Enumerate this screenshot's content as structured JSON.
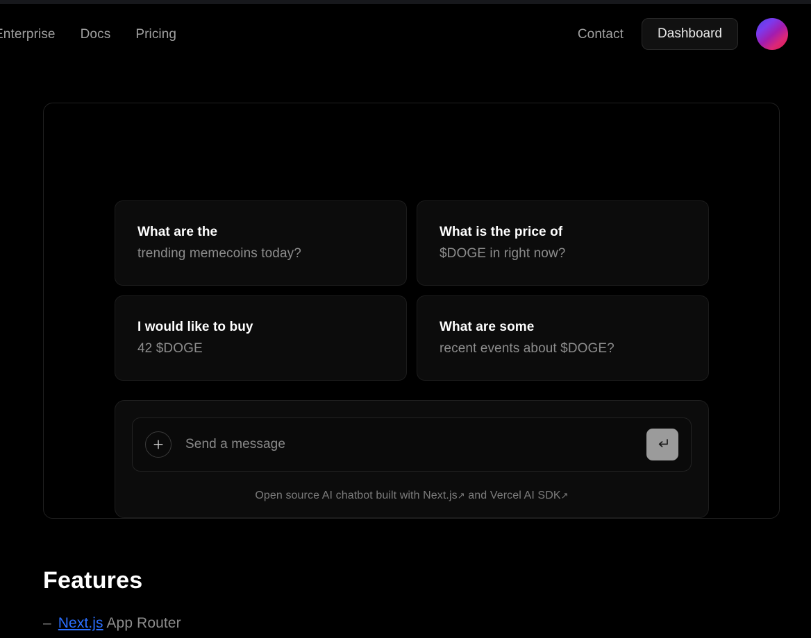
{
  "header": {
    "nav_links": [
      {
        "label": "Enterprise"
      },
      {
        "label": "Docs"
      },
      {
        "label": "Pricing"
      }
    ],
    "contact_label": "Contact",
    "dashboard_label": "Dashboard",
    "avatar_gradient_from": "#4f46e5",
    "avatar_gradient_to": "#e11d48"
  },
  "chat": {
    "suggestions": [
      {
        "title": "What are the",
        "subtitle": "trending memecoins today?"
      },
      {
        "title": "What is the price of",
        "subtitle": "$DOGE in right now?"
      },
      {
        "title": "I would like to buy",
        "subtitle": "42 $DOGE"
      },
      {
        "title": "What are some",
        "subtitle": "recent events about $DOGE?"
      }
    ],
    "composer": {
      "placeholder": "Send a message",
      "value": "",
      "attach_icon": "plus-icon",
      "send_icon": "enter-return-icon",
      "note_prefix": "Open source AI chatbot built with",
      "note_link_1": "Next.js",
      "note_middle": "and",
      "note_link_2": "Vercel AI SDK",
      "external_arrow": "↗"
    }
  },
  "features": {
    "title": "Features",
    "items": [
      {
        "dash": "–",
        "link": "Next.js",
        "rest": "App Router"
      }
    ]
  }
}
